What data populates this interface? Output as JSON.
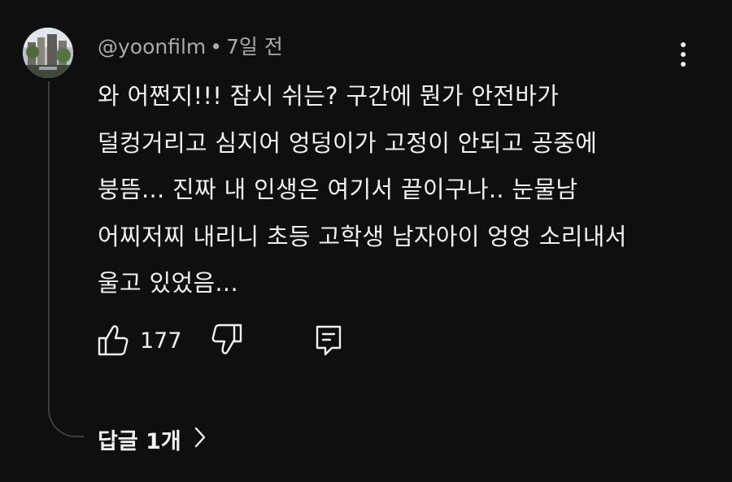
{
  "comment": {
    "author": "@yoonfilm",
    "separator": "•",
    "timestamp": "7일 전",
    "text_lines": [
      "와 어쩐지!!! 잠시 쉬는? 구간에 뭔가 안전바가",
      "덜컹거리고 심지어 엉덩이가 고정이 안되고 공중에",
      "붕뜸... 진짜 내 인생은 여기서 끝이구나.. 눈물남",
      "어찌저찌 내리니 초등 고학생 남자아이 엉엉 소리내서",
      "울고 있었음..."
    ],
    "like_count": "177",
    "replies_label": "답글 1개"
  },
  "icons": {
    "more": "more-vert-icon",
    "like": "thumbs-up-icon",
    "dislike": "thumbs-down-icon",
    "reply": "reply-comment-icon",
    "chevron": "chevron-right-icon"
  },
  "colors": {
    "background": "#0f0f0f",
    "text": "#f1f1f1",
    "secondary_text": "#aaaaaa",
    "thread_line": "#3d3d3d"
  }
}
